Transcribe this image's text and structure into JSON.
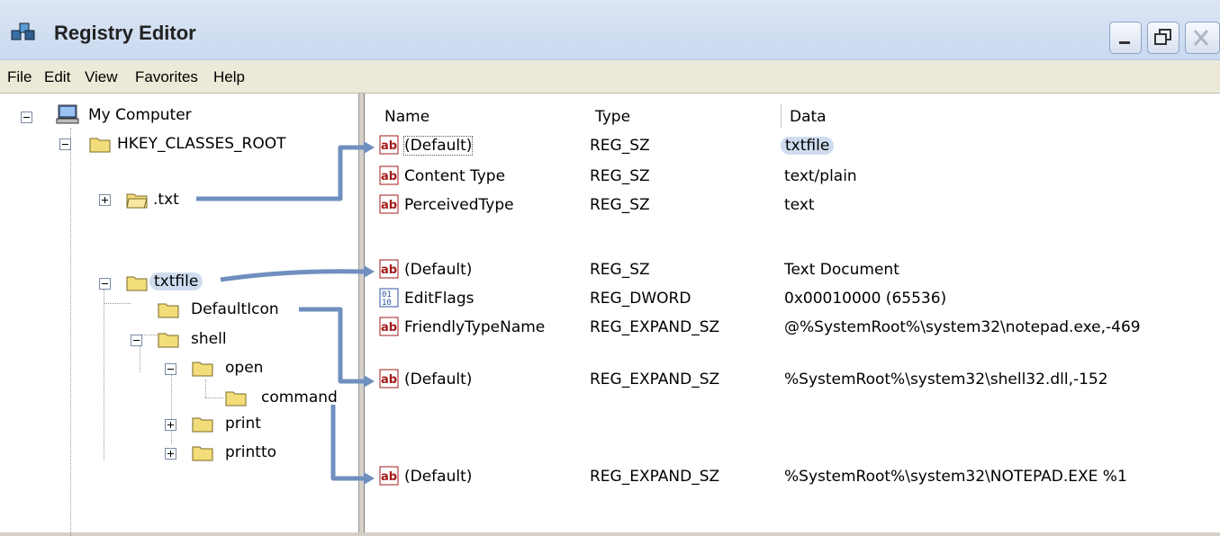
{
  "window": {
    "title": "Registry Editor"
  },
  "menu": [
    "File",
    "Edit",
    "View",
    "Favorites",
    "Help"
  ],
  "tree": {
    "root": "My Computer",
    "hkcr": "HKEY_CLASSES_ROOT",
    "txt": ".txt",
    "txtfile": "txtfile",
    "defaulticon": "DefaultIcon",
    "shell": "shell",
    "open": "open",
    "command": "command",
    "print": "print",
    "printto": "printto"
  },
  "columns": {
    "name": "Name",
    "type": "Type",
    "data": "Data"
  },
  "values": [
    {
      "name": "(Default)",
      "type": "REG_SZ",
      "data": "txtfile",
      "icon": "string-value-icon"
    },
    {
      "name": "Content Type",
      "type": "REG_SZ",
      "data": "text/plain",
      "icon": "string-value-icon"
    },
    {
      "name": "PerceivedType",
      "type": "REG_SZ",
      "data": "text",
      "icon": "string-value-icon"
    },
    {
      "name": "(Default)",
      "type": "REG_SZ",
      "data": "Text Document",
      "icon": "string-value-icon"
    },
    {
      "name": "EditFlags",
      "type": "REG_DWORD",
      "data": "0x00010000 (65536)",
      "icon": "binary-value-icon"
    },
    {
      "name": "FriendlyTypeName",
      "type": "REG_EXPAND_SZ",
      "data": "@%SystemRoot%\\system32\\notepad.exe,-469",
      "icon": "string-value-icon"
    },
    {
      "name": "(Default)",
      "type": "REG_EXPAND_SZ",
      "data": "%SystemRoot%\\system32\\shell32.dll,-152",
      "icon": "string-value-icon"
    },
    {
      "name": "(Default)",
      "type": "REG_EXPAND_SZ",
      "data": "%SystemRoot%\\system32\\NOTEPAD.EXE %1",
      "icon": "string-value-icon"
    }
  ],
  "colors": {
    "connector": "#6f8fbf",
    "highlight": "#cfdcee",
    "folder": "#f3dd7a"
  }
}
